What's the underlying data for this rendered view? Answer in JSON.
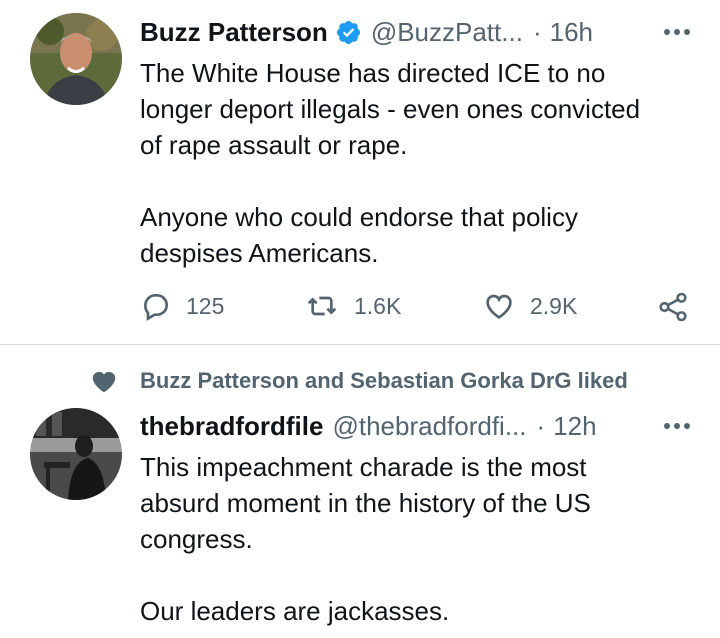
{
  "tweets": [
    {
      "name": "Buzz Patterson",
      "handle": "@BuzzPatt...",
      "dot": "·",
      "time": "16h",
      "verified": true,
      "text_lines": [
        "The White House has directed ICE to no",
        "longer deport illegals - even ones convicted",
        "of rape assault or rape.",
        "",
        "Anyone who could endorse that policy",
        "despises Americans."
      ],
      "replies": "125",
      "retweets": "1.6K",
      "likes": "2.9K"
    },
    {
      "social_context": "Buzz Patterson and Sebastian Gorka DrG liked",
      "name": "thebradfordfile",
      "handle": "@thebradfordfi...",
      "dot": "·",
      "time": "12h",
      "verified": false,
      "text_lines": [
        "This impeachment charade is the most",
        "absurd moment in the history of the US",
        "congress.",
        "",
        "Our leaders are jackasses."
      ]
    }
  ],
  "icons": {
    "reply": "reply-icon",
    "retweet": "retweet-icon",
    "like": "heart-icon",
    "share": "share-icon",
    "more": "more-icon",
    "verified": "verified-badge-icon",
    "social": "heart-filled-icon"
  },
  "colors": {
    "text": "#0f1419",
    "secondary": "#536471",
    "verified": "#1d9bf0",
    "divider": "#cfd9de"
  }
}
